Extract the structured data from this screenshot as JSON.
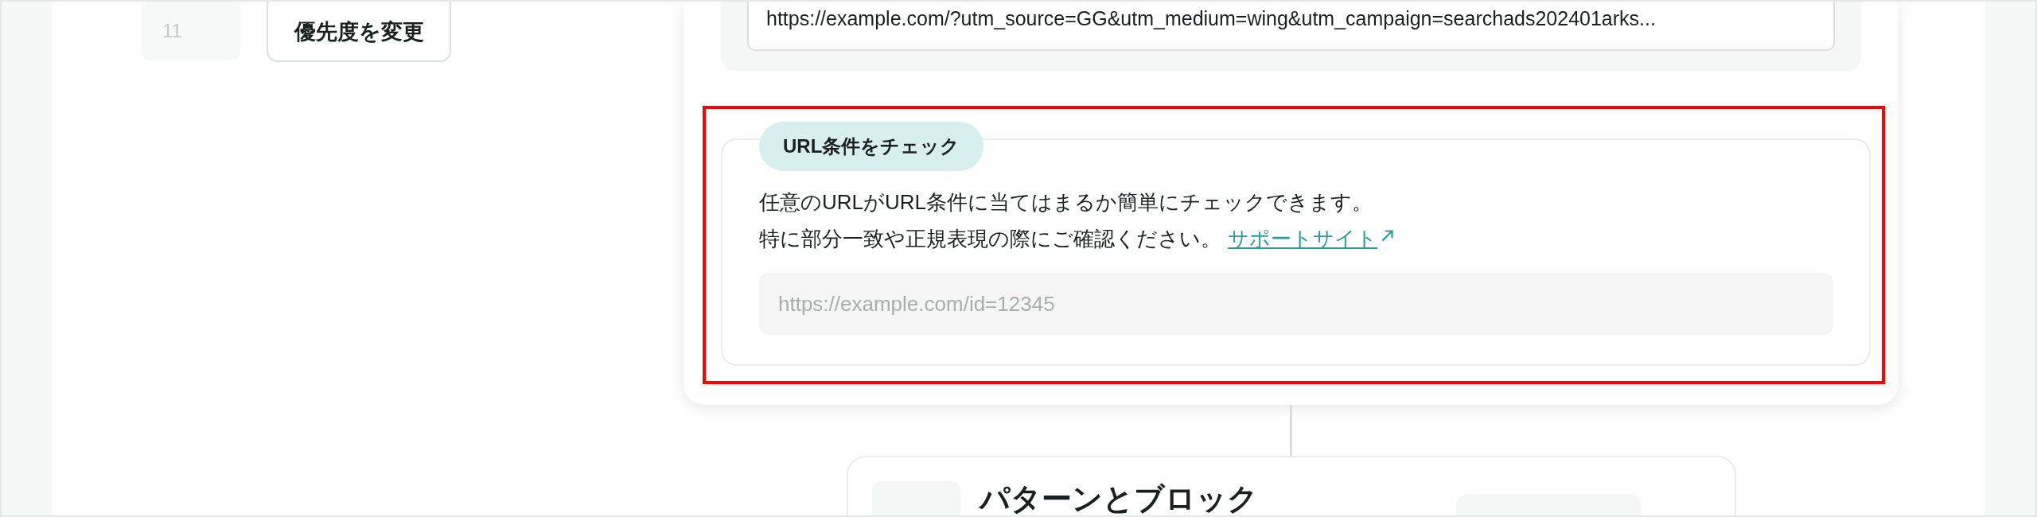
{
  "priority": {
    "field": {
      "value": "11",
      "disabled": true
    },
    "button": "優先度を変更"
  },
  "url_panel": {
    "url": "https://example.com/?utm_source=GG&utm_medium=wing&utm_campaign=searchads202401arks..."
  },
  "url_check": {
    "highlighted": true,
    "badge": "URL条件をチェック",
    "description_lines": [
      "任意のURLがURL条件に当てはまるか簡単にチェックできます。",
      "特に部分一致や正規表現の際にご確認ください。"
    ],
    "link": "サポートサイト",
    "input": {
      "placeholder": "https://example.com/id=12345"
    }
  },
  "next_step": {
    "title": "パターンとブロック"
  }
}
